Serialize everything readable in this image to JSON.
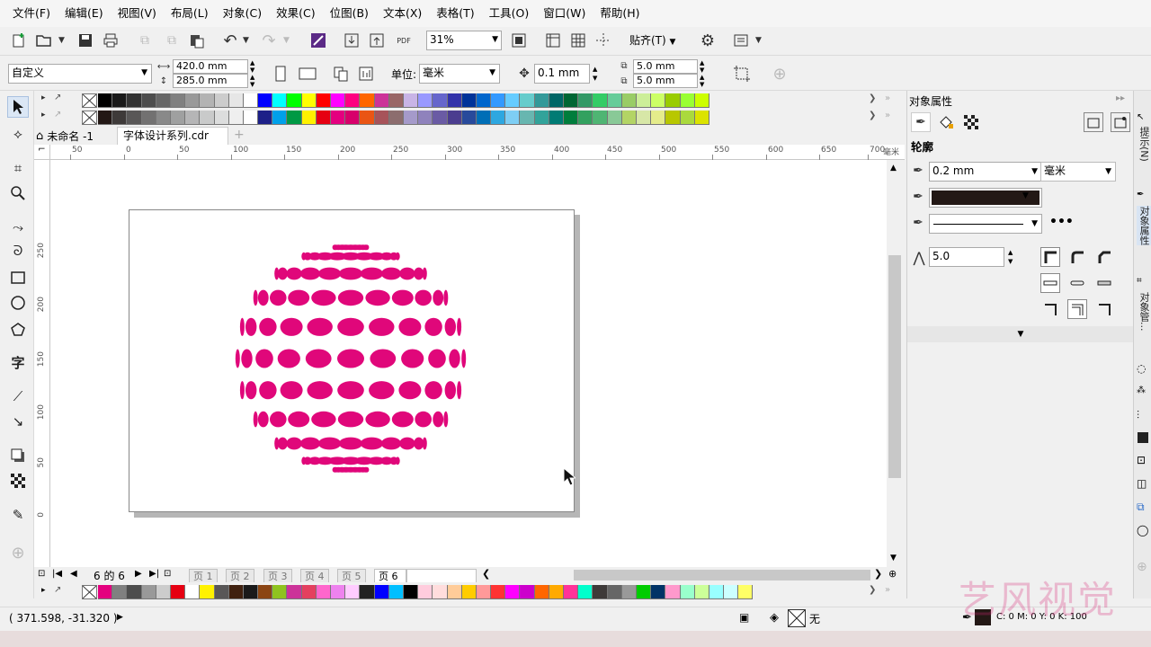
{
  "menu": [
    "文件(F)",
    "编辑(E)",
    "视图(V)",
    "布局(L)",
    "对象(C)",
    "效果(C)",
    "位图(B)",
    "文本(X)",
    "表格(T)",
    "工具(O)",
    "窗口(W)",
    "帮助(H)"
  ],
  "toolbar": {
    "zoom": "31%",
    "snap_label": "贴齐(T)"
  },
  "propbar": {
    "preset": "自定义",
    "width": "420.0 mm",
    "height": "285.0 mm",
    "unit_label": "单位:",
    "unit": "毫米",
    "nudge": "0.1 mm",
    "dup_x": "5.0 mm",
    "dup_y": "5.0 mm"
  },
  "doc_tabs": [
    {
      "label": "未命名 -1"
    },
    {
      "label": "字体设计系列.cdr"
    }
  ],
  "ruler_h": [
    "50",
    "0",
    "50",
    "100",
    "150",
    "200",
    "250",
    "300",
    "350",
    "400",
    "450",
    "500",
    "550",
    "600",
    "650",
    "700"
  ],
  "ruler_h_unit": "毫米",
  "ruler_v": [
    "250",
    "200",
    "150",
    "100",
    "50",
    "0"
  ],
  "page_nav": {
    "counter": "6 的 6",
    "pages": [
      "页 1",
      "页 2",
      "页 3",
      "页 4",
      "页 5",
      "页 6"
    ]
  },
  "docker": {
    "title": "对象属性",
    "section": "轮廓",
    "outline_width": "0.2 mm",
    "outline_unit": "毫米",
    "outline_color": "#231815",
    "miter": "5.0"
  },
  "right_tabs": [
    "提示(N)",
    "对象属性",
    "对象管..."
  ],
  "status": {
    "coords": "( 371.598, -31.320 )",
    "fill_label": "无",
    "outline_info": "C: 0 M: 0 Y: 0 K: 100"
  },
  "watermark": "艺风视觉",
  "sphere_color": "#e0077a",
  "palette_top": [
    "#000000",
    "#1a1a1a",
    "#333333",
    "#4d4d4d",
    "#666666",
    "#808080",
    "#999999",
    "#b3b3b3",
    "#cccccc",
    "#e6e6e6",
    "#ffffff",
    "#0000ff",
    "#00ffff",
    "#00ff00",
    "#ffff00",
    "#ff0000",
    "#ff00ff",
    "#ff0080",
    "#ff6600",
    "#cc3399",
    "#996666",
    "#c8b4e6",
    "#9999ff",
    "#6666cc",
    "#3333aa",
    "#003399",
    "#0066cc",
    "#3399ff",
    "#66ccff",
    "#66cccc",
    "#339999",
    "#006666",
    "#006633",
    "#339966",
    "#33cc66",
    "#66cc99",
    "#99cc66",
    "#ccee99",
    "#ccff66",
    "#99cc00",
    "#99ff33",
    "#ccff00"
  ],
  "palette_top2": [
    "#231815",
    "#3e3a39",
    "#595757",
    "#727171",
    "#898989",
    "#9fa0a0",
    "#b5b5b6",
    "#c9caca",
    "#dcdddd",
    "#efefef",
    "#ffffff",
    "#1d2088",
    "#00a0e9",
    "#009944",
    "#fff100",
    "#e60012",
    "#e4007f",
    "#d7006b",
    "#ea5514",
    "#a7535a",
    "#8c6d6e",
    "#a59aca",
    "#8f82bc",
    "#6a5ba4",
    "#4b3d8f",
    "#284a9b",
    "#006eb6",
    "#2ea7e0",
    "#7ecef4",
    "#68b6b0",
    "#32a39a",
    "#007b74",
    "#007d3c",
    "#33a15f",
    "#4fb573",
    "#89c997",
    "#b3d465",
    "#d7e7a7",
    "#e5ec8b",
    "#b8c700",
    "#aad93d",
    "#dbe300"
  ],
  "palette_bottom": [
    "#e4007f",
    "#808080",
    "#4d4d4d",
    "#999999",
    "#cccccc",
    "#e60012",
    "#ffffff",
    "#fff100",
    "#595757",
    "#40210f",
    "#1a1a1a",
    "#8b4513",
    "#8fc31f",
    "#cc3399",
    "#e4405f",
    "#ff66cc",
    "#ee82ee",
    "#ffccff",
    "#222222",
    "#0000ff",
    "#00bfff",
    "#000000",
    "#ffccdd",
    "#ffdddd",
    "#ffcc99",
    "#ffcc00",
    "#ff9999",
    "#ff3333",
    "#ff00ff",
    "#cc00cc",
    "#ff6600",
    "#ffaa00",
    "#ff3399",
    "#00ffcc",
    "#3e3a39",
    "#666666",
    "#999999",
    "#00cc00",
    "#003366",
    "#ff99cc",
    "#99ffcc",
    "#ccff99",
    "#99ffff",
    "#ccffff",
    "#ffff66"
  ]
}
